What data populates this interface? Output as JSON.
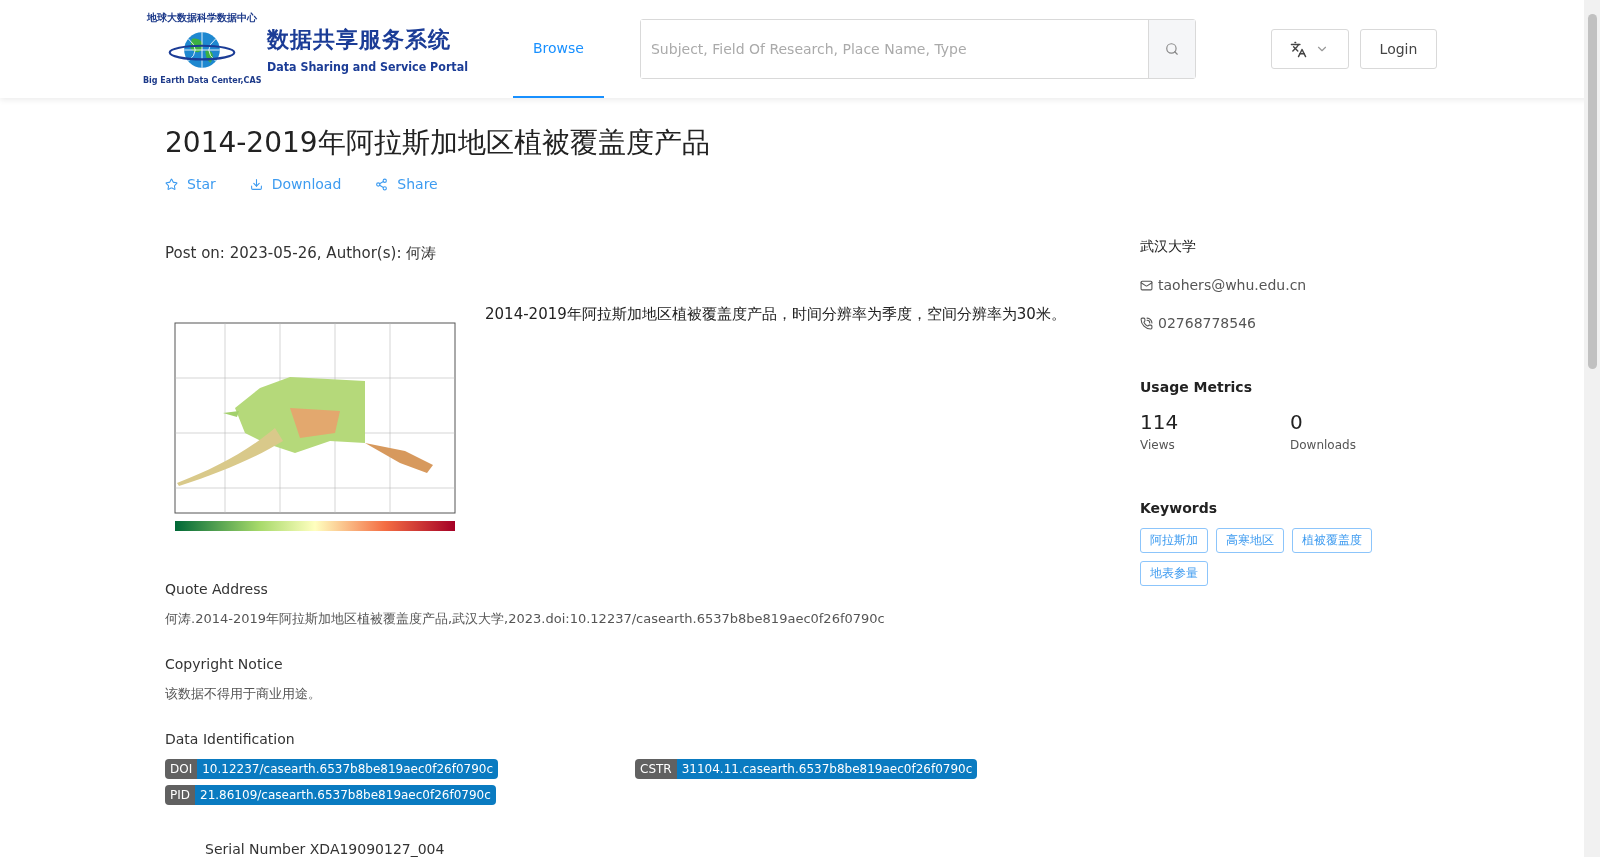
{
  "header": {
    "logo": {
      "ring_top": "地球大数据科学数据中心",
      "ring_bottom": "Big Earth Data Center,CAS",
      "title_zh": "数据共享服务系统",
      "title_en": "Data Sharing and Service Portal"
    },
    "nav": [
      {
        "label": "Browse",
        "selected": true
      }
    ],
    "search": {
      "placeholder": "Subject, Field Of Research, Place Name, Type"
    },
    "login": "Login"
  },
  "dataset": {
    "title": "2014-2019年阿拉斯加地区植被覆盖度产品",
    "actions": [
      {
        "kind": "star",
        "label": "Star"
      },
      {
        "kind": "download",
        "label": "Download"
      },
      {
        "kind": "share",
        "label": "Share"
      }
    ],
    "post": "Post on: 2023-05-26, Author(s): 何涛",
    "description": "2014-2019年阿拉斯加地区植被覆盖度产品，时间分辨率为季度，空间分辨率为30米。",
    "sections": [
      {
        "heading": "Quote Address",
        "text": "何涛.2014-2019年阿拉斯加地区植被覆盖度产品,武汉大学,2023.doi:10.12237/casearth.6537b8be819aec0f26f0790c"
      },
      {
        "heading": "Copyright Notice",
        "text": "该数据不得用于商业用途。"
      }
    ],
    "identification": {
      "heading": "Data Identification",
      "ids": [
        {
          "type": "DOI",
          "value": "10.12237/casearth.6537b8be819aec0f26f0790c"
        },
        {
          "type": "CSTR",
          "value": "31104.11.casearth.6537b8be819aec0f26f0790c"
        },
        {
          "type": "PID",
          "value": "21.86109/casearth.6537b8be819aec0f26f0790c"
        }
      ]
    },
    "serial": "Serial Number XDA19090127_004"
  },
  "sidebar": {
    "organization": "武汉大学",
    "email": "taohers@whu.edu.cn",
    "phone": "02768778546",
    "metrics": {
      "heading": "Usage Metrics",
      "items": [
        {
          "value": "114",
          "label": "Views"
        },
        {
          "value": "0",
          "label": "Downloads"
        }
      ]
    },
    "keywords": {
      "heading": "Keywords",
      "items": [
        "阿拉斯加",
        "高寒地区",
        "植被覆盖度",
        "地表参量"
      ]
    }
  }
}
